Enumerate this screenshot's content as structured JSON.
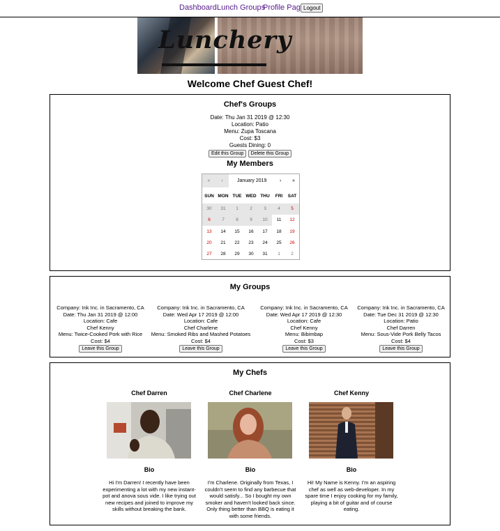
{
  "nav": {
    "dashboard": "Dashboard",
    "lunch_groups": "Lunch Groups",
    "profile": "Profile Page",
    "logout": "Logout"
  },
  "banner": {
    "logo_text": "Lunchery"
  },
  "welcome": "Welcome Chef Guest Chef!",
  "chefs_groups": {
    "title": "Chef's Groups",
    "date": "Date: Thu Jan 31 2019 @ 12:30",
    "location": "Location: Patio",
    "menu": "Menu: Zupa Toscana",
    "cost": "Cost: $3",
    "guests": "Guests Dining: 0",
    "edit_label": "Edit this Group",
    "delete_label": "Delete this Group"
  },
  "members": {
    "title": "My Members",
    "calendar": {
      "month": "January 2019",
      "nav": {
        "prev2": "«",
        "prev": "‹",
        "next": "›",
        "next2": "»"
      },
      "dows": [
        "SUN",
        "MON",
        "TUE",
        "WED",
        "THU",
        "FRI",
        "SAT"
      ],
      "days": [
        [
          "30",
          "31",
          "1",
          "2",
          "3",
          "4",
          "5"
        ],
        [
          "6",
          "7",
          "8",
          "9",
          "10",
          "11",
          "12"
        ],
        [
          "13",
          "14",
          "15",
          "16",
          "17",
          "18",
          "19"
        ],
        [
          "20",
          "21",
          "22",
          "23",
          "24",
          "25",
          "26"
        ],
        [
          "27",
          "28",
          "29",
          "30",
          "31",
          "1",
          "2"
        ]
      ]
    }
  },
  "my_groups": {
    "title": "My Groups",
    "leave_label": "Leave this Group",
    "items": [
      {
        "company": "Company: Ink Inc. in Sacramento, CA",
        "date": "Date: Thu Jan 31 2019 @ 12:00",
        "location": "Location: Cafe",
        "chef": "Chef Kenny",
        "menu": "Menu: Twice-Cooked Pork with Rice",
        "cost": "Cost: $4"
      },
      {
        "company": "Company: Ink Inc. in Sacramento, CA",
        "date": "Date: Wed Apr 17 2019 @ 12:00",
        "location": "Location: Cafe",
        "chef": "Chef Charlene",
        "menu": "Menu: Smoked Ribs and Mashed Potatoes",
        "cost": "Cost: $4"
      },
      {
        "company": "Company: Ink Inc. in Sacramento, CA",
        "date": "Date: Wed Apr 17 2019 @ 12:30",
        "location": "Location: Cafe",
        "chef": "Chef Kenny",
        "menu": "Menu: Bibimbap",
        "cost": "Cost: $3"
      },
      {
        "company": "Company: Ink Inc. in Sacramento, CA",
        "date": "Date: Tue Dec 31 2019 @ 12:30",
        "location": "Location: Patio",
        "chef": "Chef Darren",
        "menu": "Menu: Sous-Vide Pork Belly Tacos",
        "cost": "Cost: $4"
      }
    ]
  },
  "my_chefs": {
    "title": "My Chefs",
    "bio_heading": "Bio",
    "items": [
      {
        "name": "Chef Darren",
        "bio": "Hi I'm Darren! I recently have been experimenting a lot with my new instant-pot and anova sous vide. I like trying out new recipes and joined to improve my skills without breaking the bank."
      },
      {
        "name": "Chef Charlene",
        "bio": "I'm Charlene. Originally from Texas, I couldn't seem to find any barbecue that would satisfy... So I bought my own smoker and haven't looked back since. Only thing better than BBQ is eating it with some friends."
      },
      {
        "name": "Chef Kenny",
        "bio": "Hi! My Name is Kenny. I'm an aspiring chef as well as web-developer. In my spare time I enjoy cooking for my family, playing a bit of guitar and of course eating."
      }
    ]
  },
  "colors": {
    "link": "#551a8b",
    "weekend": "#d10000",
    "border": "#000000"
  }
}
